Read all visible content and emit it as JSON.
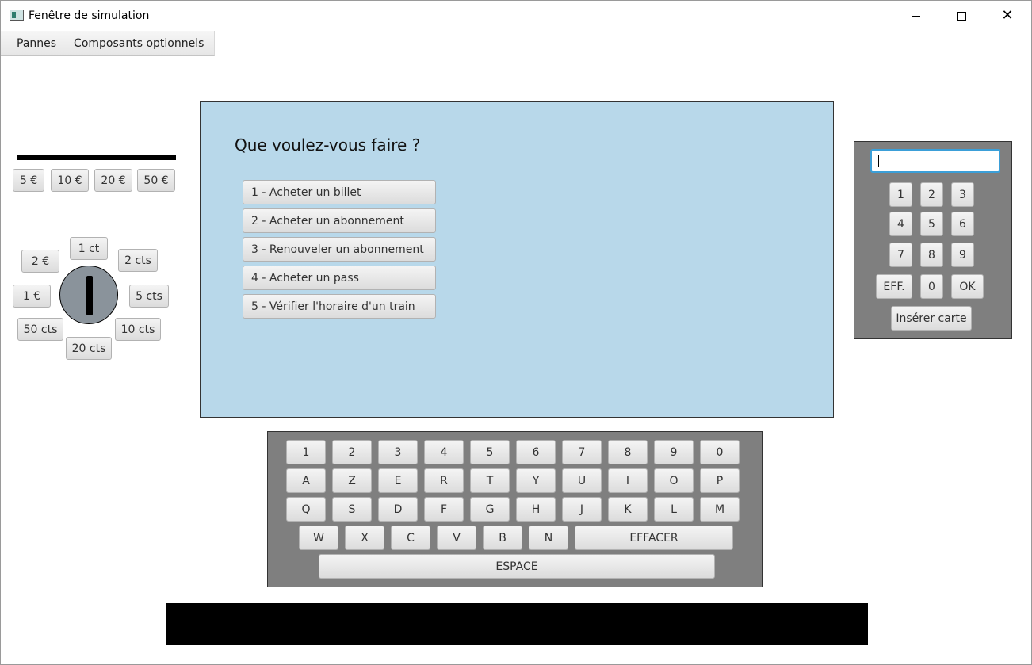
{
  "window": {
    "title": "Fenêtre de simulation"
  },
  "menu": {
    "items": [
      "Pannes",
      "Composants optionnels"
    ]
  },
  "bills": [
    "5 €",
    "10 €",
    "20 €",
    "50 €"
  ],
  "coins": {
    "one_ct": "1 ct",
    "two_cts": "2 cts",
    "five_cts": "5 cts",
    "ten_cts": "10 cts",
    "twenty_cts": "20 cts",
    "fifty_cts": "50 cts",
    "one_eur": "1 €",
    "two_eur": "2 €"
  },
  "screen": {
    "title": "Que voulez-vous faire ?",
    "options": [
      "1 - Acheter un billet",
      "2 - Acheter un abonnement",
      "3 - Renouveler un abonnement",
      "4 - Acheter un pass",
      "5 - Vérifier l'horaire d'un train"
    ],
    "background": "#b8d8ea"
  },
  "keypad": {
    "input_value": "",
    "keys": [
      "1",
      "2",
      "3",
      "4",
      "5",
      "6",
      "7",
      "8",
      "9"
    ],
    "clear_label": "EFF.",
    "zero_label": "0",
    "ok_label": "OK",
    "insert_card_label": "Insérer carte"
  },
  "keyboard": {
    "row1": [
      "1",
      "2",
      "3",
      "4",
      "5",
      "6",
      "7",
      "8",
      "9",
      "0"
    ],
    "row2": [
      "A",
      "Z",
      "E",
      "R",
      "T",
      "Y",
      "U",
      "I",
      "O",
      "P"
    ],
    "row3": [
      "Q",
      "S",
      "D",
      "F",
      "G",
      "H",
      "J",
      "K",
      "L",
      "M"
    ],
    "row4": [
      "W",
      "X",
      "C",
      "V",
      "B",
      "N"
    ],
    "erase_label": "EFFACER",
    "space_label": "ESPACE"
  },
  "colors": {
    "panel": "#7f7f7f",
    "focus": "#3b9fd8"
  }
}
